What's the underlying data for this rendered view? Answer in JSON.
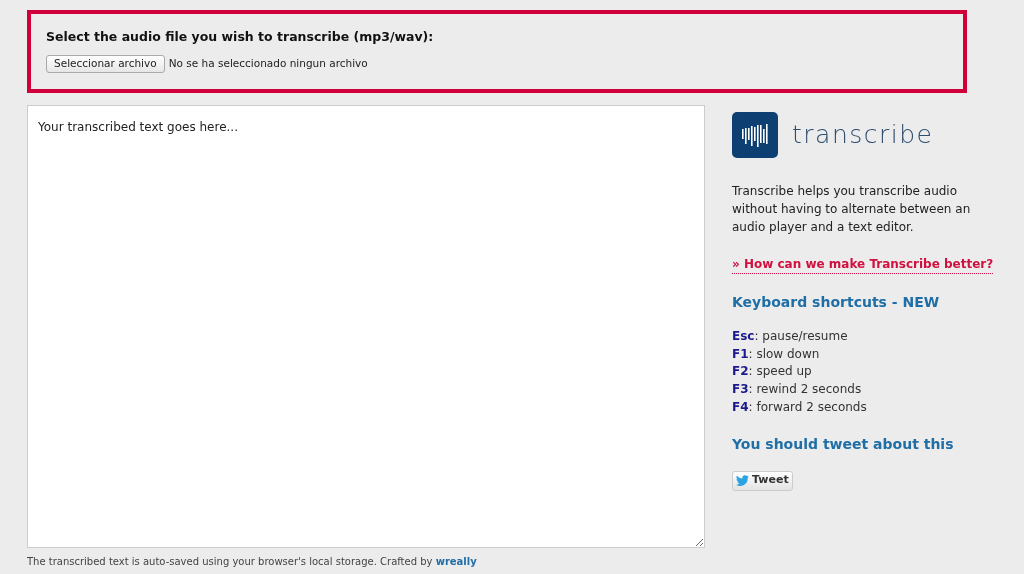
{
  "upload": {
    "label": "Select the audio file you wish to transcribe (mp3/wav):",
    "button": "Seleccionar archivo",
    "status": "No se ha seleccionado ningun archivo"
  },
  "editor": {
    "placeholder": "Your transcribed text goes here..."
  },
  "sidebar": {
    "logo_text": "transcribe",
    "description": "Transcribe helps you transcribe audio without having to alternate between an audio player and a text editor.",
    "feedback_link": "» How can we make Transcribe better?",
    "shortcuts_heading": "Keyboard shortcuts - NEW",
    "shortcuts": [
      "**Esc**: pause/resume",
      "**F1**: slow down",
      "**F2**: speed up",
      "**F3**: rewind 2 seconds",
      "**F4**: forward 2 seconds"
    ],
    "tweet_heading": "You should tweet about this",
    "tweet_button": "Tweet"
  },
  "footer": {
    "text": "The transcribed text is auto-saved using your browser's local storage. Crafted by",
    "link": "wreally"
  }
}
